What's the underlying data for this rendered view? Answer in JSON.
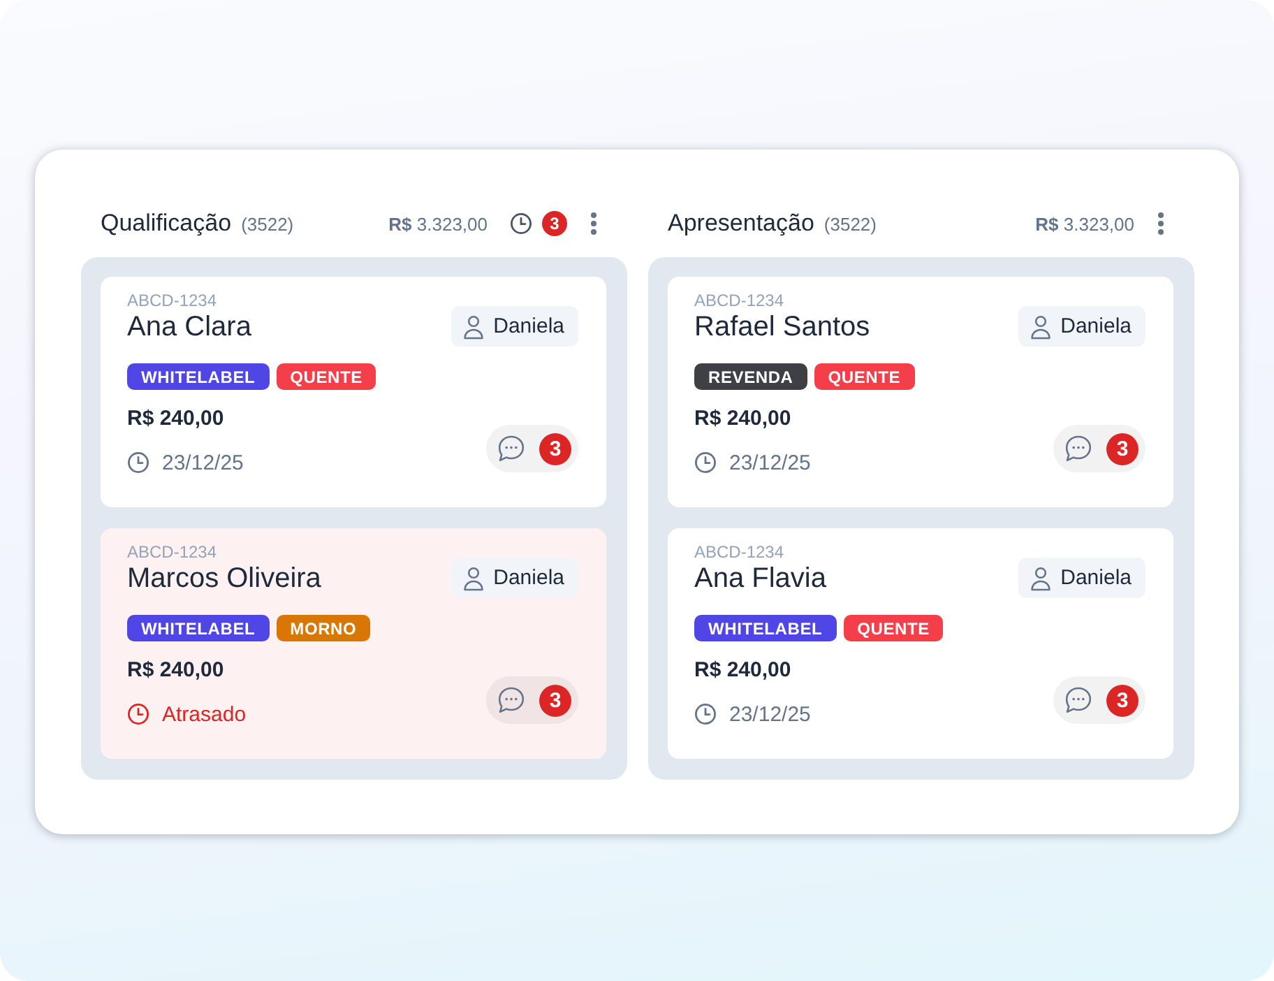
{
  "columns": [
    {
      "title": "Qualificação",
      "count": "(3522)",
      "total": "**R$** 3.323,00",
      "alert_count": "3",
      "cards": [
        {
          "code": "ABCD-1234",
          "name": "Ana Clara",
          "owner": "Daniela",
          "tags": [
            {
              "label": "WHITELABEL",
              "color": "#4f46e5"
            },
            {
              "label": "QUENTE",
              "color": "#f43f4a"
            }
          ],
          "price": "R$ 240,00",
          "due": "23/12/25",
          "overdue": false,
          "comments": "3"
        },
        {
          "code": "ABCD-1234",
          "name": "Marcos Oliveira",
          "owner": "Daniela",
          "tags": [
            {
              "label": "WHITELABEL",
              "color": "#4f46e5"
            },
            {
              "label": "MORNO",
              "color": "#d97706"
            }
          ],
          "price": "R$ 240,00",
          "due": "Atrasado",
          "overdue": true,
          "comments": "3"
        }
      ]
    },
    {
      "title": "Apresentação",
      "count": "(3522)",
      "total": "**R$** 3.323,00",
      "cards": [
        {
          "code": "ABCD-1234",
          "name": "Rafael Santos",
          "owner": "Daniela",
          "tags": [
            {
              "label": "REVENDA",
              "color": "#3f3f46"
            },
            {
              "label": "QUENTE",
              "color": "#f43f4a"
            }
          ],
          "price": "R$ 240,00",
          "due": "23/12/25",
          "overdue": false,
          "comments": "3"
        },
        {
          "code": "ABCD-1234",
          "name": "Ana Flavia",
          "owner": "Daniela",
          "tags": [
            {
              "label": "WHITELABEL",
              "color": "#4f46e5"
            },
            {
              "label": "QUENTE",
              "color": "#f43f4a"
            }
          ],
          "price": "R$ 240,00",
          "due": "23/12/25",
          "overdue": false,
          "comments": "3"
        }
      ]
    }
  ]
}
